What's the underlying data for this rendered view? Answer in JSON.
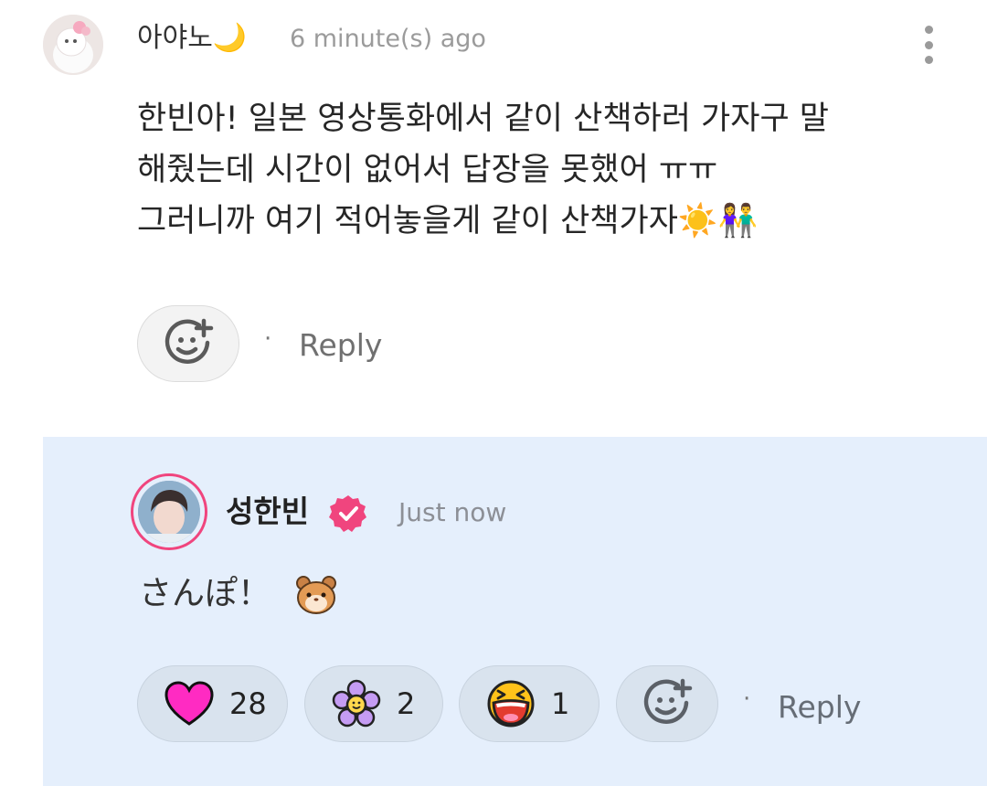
{
  "comment": {
    "username": "아야노🌙",
    "timestamp": "6 minute(s) ago",
    "lines": [
      "한빈아! 일본 영상통화에서 같이 산책하러 가자구 말",
      "해줬는데 시간이 없어서 답장을 못했어 ㅠㅠ",
      "그러니까 여기 적어놓을게 같이 산책가자☀️👫"
    ],
    "reply_label": "Reply",
    "icons": {
      "more": "more-vertical-icon",
      "add_reaction": "add-reaction-icon"
    }
  },
  "reply": {
    "username": "성한빈",
    "verified_icon": "verified-badge-icon",
    "timestamp": "Just now",
    "text": "さんぽ！",
    "emoji_icon": "hamster-face-icon",
    "reactions": [
      {
        "icon": "heart-icon",
        "count": "28"
      },
      {
        "icon": "flower-icon",
        "count": "2"
      },
      {
        "icon": "laughing-face-icon",
        "count": "1"
      }
    ],
    "reply_label": "Reply",
    "colors": {
      "avatar_ring": "#f0457e",
      "heart": "#ff2bc2",
      "background": "#e5effc"
    }
  }
}
